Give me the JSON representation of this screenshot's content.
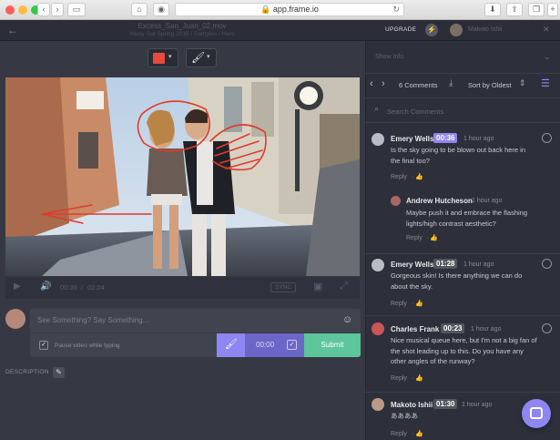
{
  "browser": {
    "url": "app.frame.io"
  },
  "header": {
    "title": "Excess_San_Juan_02.mov",
    "subtitle": "Nasty Gal Spring 2015 / Samples / Hero",
    "upgrade_label": "UPGRADE",
    "user_name": "Makoto Ishii"
  },
  "toolbar": {
    "color_accent": "#e84b3c"
  },
  "player": {
    "current_time": "00:36",
    "total_time": "02:24",
    "sync_label": "SYNC"
  },
  "composer": {
    "placeholder": "See Something? Say Something...",
    "pause_label": "Pause video while typing",
    "timecode": "00:00",
    "submit_label": "Submit"
  },
  "description": {
    "label": "DESCRIPTION"
  },
  "panel": {
    "show_info": "Show Info",
    "comments_count": "6 Comments",
    "sort_label": "Sort by Oldest",
    "search_placeholder": "Search Comments"
  },
  "comments": [
    {
      "name": "Emery Wells",
      "timecode": "00:36",
      "ago": "1 hour ago",
      "text": [
        "Is the sky going to be blown out back here in",
        "the final too?"
      ],
      "reply": "Reply",
      "avatar": "#b9bcc4"
    },
    {
      "name": "Andrew Hutcheson",
      "ago": "1 hour ago",
      "text": [
        "Maybe push it and embrace the flashing",
        "lights/high contrast aesthetic?"
      ],
      "reply": "Reply",
      "avatar": "#a66"
    },
    {
      "name": "Emery Wells",
      "timecode": "01:28",
      "ago": "1 hour ago",
      "text": [
        "Gorgeous skin! Is there anything we can do",
        "about the sky."
      ],
      "reply": "Reply",
      "avatar": "#b9bcc4"
    },
    {
      "name": "Charles Frank",
      "timecode": "00:23",
      "ago": "1 hour ago",
      "text": [
        "Nice musical queue here, but I'm not a big fan of",
        "the shot leading up to this. Do you have any",
        "other angles of the runway?"
      ],
      "reply": "Reply",
      "avatar": "#c55"
    },
    {
      "name": "Makoto Ishii",
      "timecode": "01:30",
      "ago": "1 hour ago",
      "text": [
        "ああああ"
      ],
      "reply": "Reply",
      "avatar": "#b98"
    }
  ]
}
